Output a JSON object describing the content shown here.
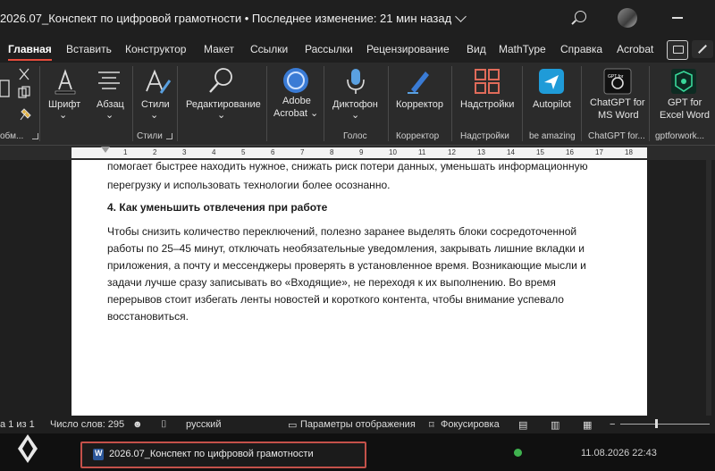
{
  "titlebar": {
    "title": "2026.07_Конспект по цифровой грамотности • Последнее изменение: 21 мин назад"
  },
  "tabs": [
    "Главная",
    "Вставить",
    "Конструктор",
    "Макет",
    "Ссылки",
    "Рассылки",
    "Рецензирование",
    "Вид",
    "MathType",
    "Справка",
    "Acrobat"
  ],
  "ribbon": {
    "paste_group_label": "обм...",
    "font": "Шрифт",
    "paragraph": "Абзац",
    "styles": "Стили",
    "styles_group": "Стили",
    "editing": "Редактирование",
    "adobe": "Adobe",
    "acrobat": "Acrobat",
    "dictate": "Диктофон",
    "voice_group": "Голос",
    "editor": "Корректор",
    "editor_group": "Корректор",
    "addins": "Надстройки",
    "addins_group": "Надстройки",
    "autopilot": "Autopilot",
    "autopilot_group": "be amazing",
    "chatgpt": "ChatGPT for",
    "chatgpt2": "MS Word",
    "chatgpt_group": "ChatGPT for...",
    "gpt_excel": "GPT for",
    "gpt_excel2": "Excel Word",
    "gpt_excel_group": "gptforwork...",
    "chatgpt_badge": "GPT for"
  },
  "ruler": {
    "numbers": [
      "1",
      "2",
      "3",
      "4",
      "5",
      "6",
      "7",
      "8",
      "9",
      "10",
      "11",
      "12",
      "13",
      "14",
      "15",
      "16",
      "17",
      "18"
    ]
  },
  "document": {
    "para1_line1": "помогает быстрее находить нужное, снижать риск потери данных, уменьшать информационную",
    "para1_line2": "перегрузку и использовать технологии более осознанно.",
    "heading": "4. Как уменьшить отвлечения при работе",
    "para2_l1": "Чтобы снизить количество переключений, полезно заранее выделять блоки сосредоточенной",
    "para2_l2": "работы по 25–45 минут, отключать необязательные уведомления, закрывать лишние вкладки и",
    "para2_l3": "приложения, а почту и мессенджеры проверять в установленное время. Возникающие мысли и",
    "para2_l4": "задачи лучше сразу записывать во «Входящие», не переходя к их выполнению. Во время",
    "para2_l5": "перерывов стоит избегать ленты новостей и короткого контента, чтобы внимание успевало",
    "para2_l6": "восстановиться."
  },
  "status": {
    "page": "а 1 из 1",
    "words": "Число слов: 295",
    "language": "русский",
    "display_settings": "Параметры отображения",
    "focus": "Фокусировка",
    "zoom_fraction": 0.4
  },
  "taskbar": {
    "task_label": "2026.07_Конспект по цифровой грамотности",
    "datetime": "11.08.2026 22:43"
  },
  "colors": {
    "accent_tab_underline": "#e74c3c",
    "taskbar_highlight": "#c4514a",
    "status_ok": "#3fb24f"
  }
}
